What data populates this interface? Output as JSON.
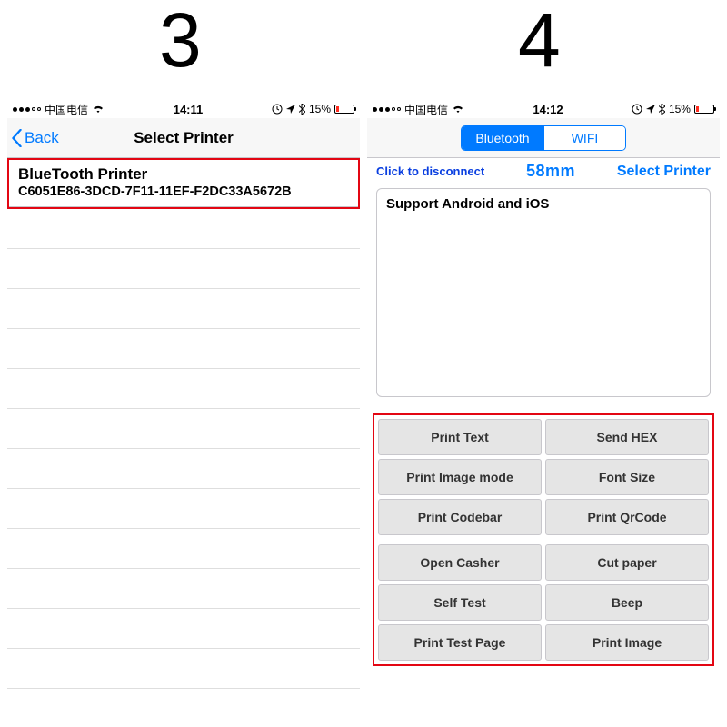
{
  "labels": {
    "three": "3",
    "four": "4"
  },
  "status": {
    "carrier": "中国电信",
    "battery_text": "15%"
  },
  "left": {
    "time": "14:11",
    "back_label": "Back",
    "title": "Select Printer",
    "printer": {
      "name": "BlueTooth Printer",
      "uuid": "C6051E86-3DCD-7F11-11EF-F2DC33A5672B"
    }
  },
  "right": {
    "time": "14:12",
    "segments": {
      "bluetooth": "Bluetooth",
      "wifi": "WIFI"
    },
    "conn": {
      "disconnect": "Click to disconnect",
      "size": "58mm",
      "select_printer": "Select Printer"
    },
    "support_text": "Support Android and iOS",
    "buttons": {
      "print_text": "Print Text",
      "send_hex": "Send HEX",
      "print_image_mode": "Print Image mode",
      "font_size": "Font Size",
      "print_codebar": "Print Codebar",
      "print_qrcode": "Print QrCode",
      "open_casher": "Open Casher",
      "cut_paper": "Cut paper",
      "self_test": "Self Test",
      "beep": "Beep",
      "print_test_page": "Print Test Page",
      "print_image": "Print Image"
    }
  }
}
